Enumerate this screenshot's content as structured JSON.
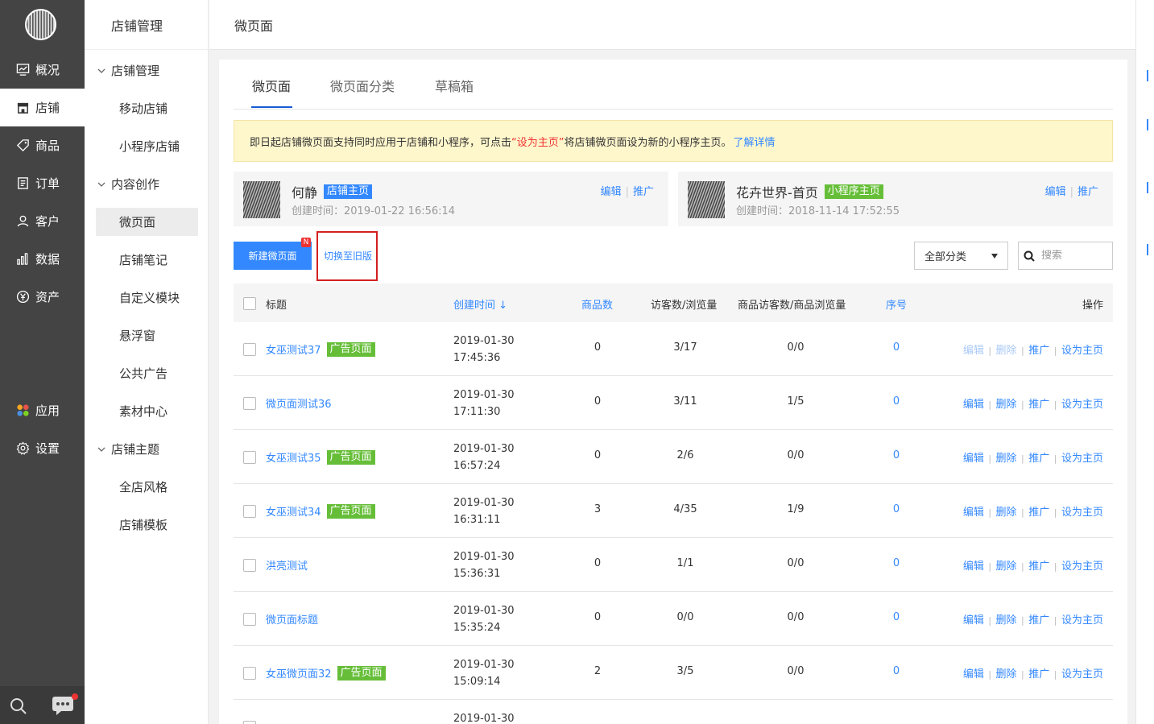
{
  "primary_nav": [
    {
      "label": "概况",
      "icon": "overview-icon"
    },
    {
      "label": "店铺",
      "icon": "store-icon",
      "active": true
    },
    {
      "label": "商品",
      "icon": "tag-icon"
    },
    {
      "label": "订单",
      "icon": "order-icon"
    },
    {
      "label": "客户",
      "icon": "user-icon"
    },
    {
      "label": "数据",
      "icon": "chart-icon"
    },
    {
      "label": "资产",
      "icon": "yen-icon"
    },
    {
      "label": "应用",
      "icon": "apps-icon"
    },
    {
      "label": "设置",
      "icon": "gear-icon"
    }
  ],
  "secondary": {
    "header": "店铺管理",
    "items": [
      {
        "label": "店铺管理",
        "type": "group"
      },
      {
        "label": "移动店铺",
        "type": "item"
      },
      {
        "label": "小程序店铺",
        "type": "item"
      },
      {
        "label": "内容创作",
        "type": "group"
      },
      {
        "label": "微页面",
        "type": "item",
        "active": true
      },
      {
        "label": "店铺笔记",
        "type": "item"
      },
      {
        "label": "自定义模块",
        "type": "item"
      },
      {
        "label": "悬浮窗",
        "type": "item"
      },
      {
        "label": "公共广告",
        "type": "item"
      },
      {
        "label": "素材中心",
        "type": "item"
      },
      {
        "label": "店铺主题",
        "type": "group"
      },
      {
        "label": "全店风格",
        "type": "item"
      },
      {
        "label": "店铺模板",
        "type": "item"
      }
    ]
  },
  "header": {
    "title": "微页面"
  },
  "tabs": [
    "微页面",
    "微页面分类",
    "草稿箱"
  ],
  "notice": {
    "before": "即日起店铺微页面支持同时应用于店铺和小程序，可点击",
    "highlight": "“设为主页”",
    "after": "将店铺微页面设为新的小程序主页。",
    "link": "了解详情"
  },
  "home_pages": [
    {
      "name": "何静",
      "badge": "店铺主页",
      "badge_color": "#3388ff",
      "created": "创建时间：2019-01-22 16:56:14",
      "edit": "编辑",
      "promote": "推广"
    },
    {
      "name": "花卉世界-首页",
      "badge": "小程序主页",
      "badge_color": "#66be38",
      "created": "创建时间：2018-11-14 17:52:55",
      "edit": "编辑",
      "promote": "推广"
    }
  ],
  "toolbar": {
    "new_button": "新建微页面",
    "new_tag": "N",
    "switch_link": "切换至旧版",
    "category_select": "全部分类",
    "search_placeholder": "搜索"
  },
  "table": {
    "headers": {
      "title": "标题",
      "created": "创建时间",
      "goods": "商品数",
      "visitors": "访客数/浏览量",
      "goods_visitors": "商品访客数/商品浏览量",
      "order": "序号",
      "ops": "操作"
    },
    "ops_labels": {
      "edit": "编辑",
      "delete": "删除",
      "promote": "推广",
      "set_home": "设为主页"
    },
    "rows": [
      {
        "title": "女巫测试37",
        "badge": "广告页面",
        "date": "2019-01-30",
        "time": "17:45:36",
        "goods": "0",
        "visitors": "3/17",
        "goods_visitors": "0/0",
        "order": "0",
        "disabled": true
      },
      {
        "title": "微页面测试36",
        "badge": "",
        "date": "2019-01-30",
        "time": "17:11:30",
        "goods": "0",
        "visitors": "3/11",
        "goods_visitors": "1/5",
        "order": "0",
        "disabled": false
      },
      {
        "title": "女巫测试35",
        "badge": "广告页面",
        "date": "2019-01-30",
        "time": "16:57:24",
        "goods": "0",
        "visitors": "2/6",
        "goods_visitors": "0/0",
        "order": "0",
        "disabled": false
      },
      {
        "title": "女巫测试34",
        "badge": "广告页面",
        "date": "2019-01-30",
        "time": "16:31:11",
        "goods": "3",
        "visitors": "4/35",
        "goods_visitors": "1/9",
        "order": "0",
        "disabled": false
      },
      {
        "title": "洪亮测试",
        "badge": "",
        "date": "2019-01-30",
        "time": "15:36:31",
        "goods": "0",
        "visitors": "1/1",
        "goods_visitors": "0/0",
        "order": "0",
        "disabled": false
      },
      {
        "title": "微页面标题",
        "badge": "",
        "date": "2019-01-30",
        "time": "15:35:24",
        "goods": "0",
        "visitors": "0/0",
        "goods_visitors": "0/0",
        "order": "0",
        "disabled": false
      },
      {
        "title": "女巫微页面32",
        "badge": "广告页面",
        "date": "2019-01-30",
        "time": "15:09:14",
        "goods": "2",
        "visitors": "3/5",
        "goods_visitors": "0/0",
        "order": "0",
        "disabled": false
      },
      {
        "title": "",
        "badge": "",
        "date": "2019-01-30",
        "time": "",
        "goods": "",
        "visitors": "",
        "goods_visitors": "",
        "order": "",
        "disabled": false
      }
    ]
  },
  "colors": {
    "accent": "#3388ff",
    "sidebar": "#444444",
    "ad_badge": "#66be38",
    "highlight_box": "#d42020"
  }
}
